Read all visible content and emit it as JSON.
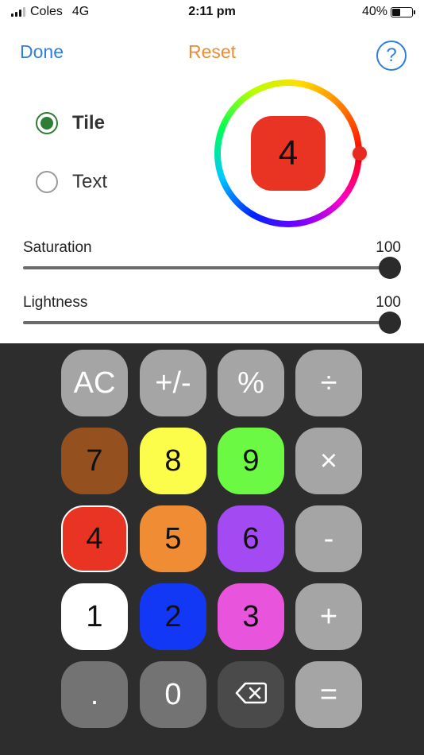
{
  "status": {
    "carrier": "Coles",
    "network": "4G",
    "time": "2:11 pm",
    "battery": "40%"
  },
  "nav": {
    "done": "Done",
    "reset": "Reset",
    "help": "?"
  },
  "mode": {
    "tile": "Tile",
    "text": "Text",
    "selected": "tile"
  },
  "preview": {
    "digit": "4",
    "color": "#ea3423"
  },
  "sliders": {
    "saturation": {
      "label": "Saturation",
      "value": "100"
    },
    "lightness": {
      "label": "Lightness",
      "value": "100"
    }
  },
  "keys": [
    {
      "label": "AC",
      "bg": "#a5a5a5",
      "fg": "#ffffff",
      "name": "all-clear"
    },
    {
      "label": "+/-",
      "bg": "#a5a5a5",
      "fg": "#ffffff",
      "name": "plus-minus"
    },
    {
      "label": "%",
      "bg": "#a5a5a5",
      "fg": "#ffffff",
      "name": "percent"
    },
    {
      "label": "÷",
      "bg": "#a5a5a5",
      "fg": "#ffffff",
      "name": "divide"
    },
    {
      "label": "7",
      "bg": "#95501f",
      "fg": "#111111",
      "name": "digit-7"
    },
    {
      "label": "8",
      "bg": "#fbfd4a",
      "fg": "#111111",
      "name": "digit-8"
    },
    {
      "label": "9",
      "bg": "#6cf944",
      "fg": "#111111",
      "name": "digit-9"
    },
    {
      "label": "×",
      "bg": "#a5a5a5",
      "fg": "#ffffff",
      "name": "multiply"
    },
    {
      "label": "4",
      "bg": "#ea3423",
      "fg": "#111111",
      "name": "digit-4",
      "selected": true
    },
    {
      "label": "5",
      "bg": "#f08c33",
      "fg": "#111111",
      "name": "digit-5"
    },
    {
      "label": "6",
      "bg": "#a34af2",
      "fg": "#111111",
      "name": "digit-6"
    },
    {
      "label": "-",
      "bg": "#a5a5a5",
      "fg": "#ffffff",
      "name": "minus"
    },
    {
      "label": "1",
      "bg": "#ffffff",
      "fg": "#111111",
      "name": "digit-1"
    },
    {
      "label": "2",
      "bg": "#1338f5",
      "fg": "#111111",
      "name": "digit-2"
    },
    {
      "label": "3",
      "bg": "#e954dd",
      "fg": "#111111",
      "name": "digit-3"
    },
    {
      "label": "+",
      "bg": "#a5a5a5",
      "fg": "#ffffff",
      "name": "plus"
    },
    {
      "label": ".",
      "bg": "#737373",
      "fg": "#ffffff",
      "name": "decimal"
    },
    {
      "label": "0",
      "bg": "#737373",
      "fg": "#ffffff",
      "name": "digit-0"
    },
    {
      "label": "",
      "bg": "#4a4a4a",
      "fg": "#ffffff",
      "name": "backspace",
      "icon": "backspace-icon"
    },
    {
      "label": "=",
      "bg": "#a5a5a5",
      "fg": "#ffffff",
      "name": "equals"
    }
  ]
}
